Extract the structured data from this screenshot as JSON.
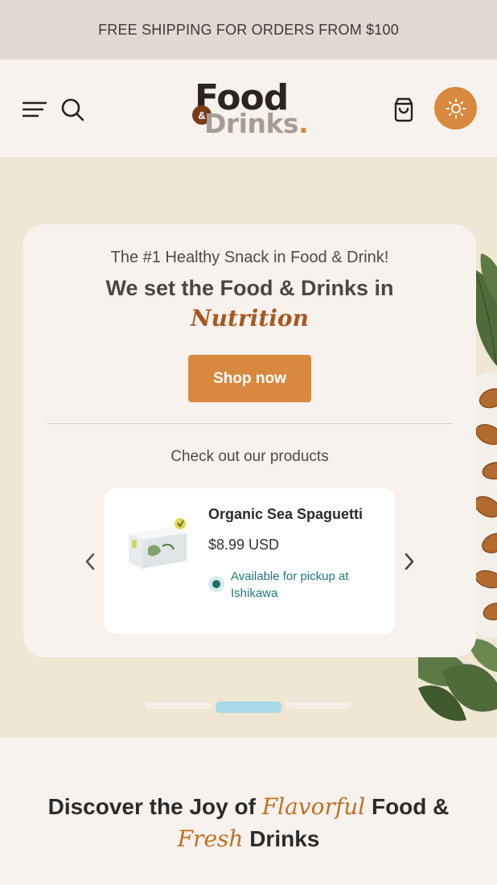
{
  "announcement": "FREE SHIPPING FOR ORDERS FROM $100",
  "header": {
    "logo_top": "Food",
    "logo_amp": "&",
    "logo_bottom": "Drinks",
    "logo_dot": ".",
    "icons": [
      "menu-icon",
      "search-icon",
      "cart-icon",
      "sun-icon"
    ],
    "accent_color": "#d9893f"
  },
  "hero": {
    "tagline": "The #1 Healthy Snack in Food & Drink!",
    "headline": "We set the Food & Drinks in",
    "headline_accent": "Nutrition",
    "cta_label": "Shop now",
    "products_heading": "Check out our products",
    "product": {
      "name": "Organic Sea Spaguetti",
      "price": "$8.99 USD",
      "availability": "Available for pickup at Ishikawa",
      "availability_color": "#1f7a7a"
    },
    "carousel": {
      "slide_count": 3,
      "active_index": 1
    }
  },
  "discover": {
    "part1": "Discover the Joy of ",
    "accent1": "Flavorful",
    "part2": " Food &",
    "accent2": "Fresh",
    "part3": " Drinks"
  }
}
